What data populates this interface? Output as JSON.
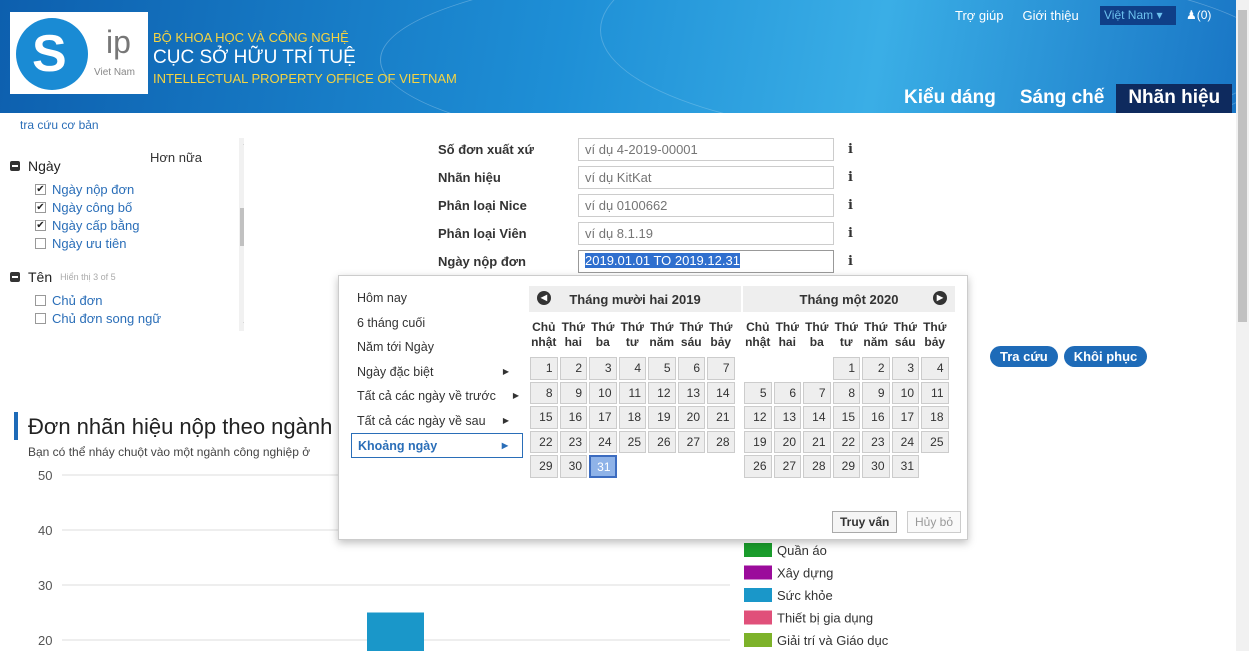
{
  "header": {
    "logo_ip": "ip",
    "logo_vn": "Viet Nam",
    "org_line1": "BỘ KHOA HỌC VÀ CÔNG NGHỆ",
    "org_line2": "CỤC SỞ HỮU TRÍ TUỆ",
    "org_line3": "INTELLECTUAL PROPERTY OFFICE OF VIETNAM",
    "help": "Trợ giúp",
    "about": "Giới thiệu",
    "country": "Việt Nam ▾",
    "cart": "(0)",
    "tabs": [
      "Kiểu dáng",
      "Sáng chế",
      "Nhãn hiệu"
    ]
  },
  "basic_search": "tra cứu cơ bản",
  "sidebar": {
    "group_date": "Ngày",
    "more": "Hơn nữa",
    "date_items": [
      "Ngày nộp đơn",
      "Ngày công bố",
      "Ngày cấp bằng",
      "Ngày ưu tiên"
    ],
    "group_name": "Tên",
    "name_hint": "Hiển thị 3 of 5",
    "name_items": [
      "Chủ đơn",
      "Chủ đơn song ngữ"
    ]
  },
  "form": {
    "rows": [
      {
        "label": "Số đơn xuất xứ",
        "placeholder": "ví dụ 4-2019-00001"
      },
      {
        "label": "Nhãn hiệu",
        "placeholder": "ví dụ KitKat"
      },
      {
        "label": "Phân loại Nice",
        "placeholder": "ví dụ 0100662"
      },
      {
        "label": "Phân loại Viên",
        "placeholder": "ví dụ 8.1.19"
      },
      {
        "label": "Ngày nộp đơn",
        "value": "2019.01.01 TO 2019.12.31"
      }
    ],
    "info": "i"
  },
  "buttons": {
    "search": "Tra cứu",
    "reset": "Khôi phục"
  },
  "section": {
    "title": "Đơn nhãn hiệu nộp theo ngành",
    "subtitle": "Bạn có thể nháy chuột vào một ngành công nghiệp ở"
  },
  "datepicker": {
    "ranges": [
      "Hôm nay",
      "6 tháng cuối",
      "Năm tới Ngày",
      "Ngày đặc biệt",
      "Tất cả các ngày về trước",
      "Tất cả các ngày về sau",
      "Khoảng ngày"
    ],
    "left_month": "Tháng mười hai 2019",
    "right_month": "Tháng một 2020",
    "dow": [
      [
        "Chủ",
        "nhật"
      ],
      [
        "Thứ",
        "hai"
      ],
      [
        "Thứ",
        "ba"
      ],
      [
        "Thứ",
        "tư"
      ],
      [
        "Thứ",
        "năm"
      ],
      [
        "Thứ",
        "sáu"
      ],
      [
        "Thứ",
        "bảy"
      ]
    ],
    "query": "Truy vấn",
    "cancel": "Hủy bỏ"
  },
  "chart_data": {
    "type": "bar",
    "yticks": [
      50,
      40,
      30,
      20
    ],
    "ylim": [
      0,
      50
    ],
    "series": [
      {
        "values": [
          25
        ],
        "color": "#1a97c9"
      }
    ],
    "legend": [
      {
        "name": "Quần áo",
        "color": "#1a9c2c"
      },
      {
        "name": "Xây dựng",
        "color": "#9b0b9b"
      },
      {
        "name": "Sức khỏe",
        "color": "#1a97c9"
      },
      {
        "name": "Thiết bị gia dụng",
        "color": "#e0507a"
      },
      {
        "name": "Giải trí và Giáo dục",
        "color": "#7db22a"
      }
    ]
  }
}
